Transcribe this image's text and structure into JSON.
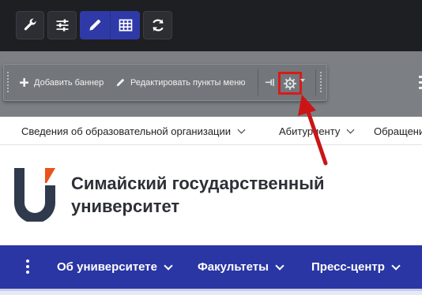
{
  "admin_toolbar": {
    "buttons": [
      {
        "icon": "wrench-icon"
      },
      {
        "icon": "sliders-icon"
      },
      {
        "icon": "pencil-icon",
        "active": true
      },
      {
        "icon": "table-grid-icon",
        "active": true
      },
      {
        "icon": "refresh-icon"
      }
    ],
    "active_color": "#2f3aa8"
  },
  "edit_toolbar": {
    "add_banner_label": "Добавить баннер",
    "edit_menu_label": "Редактировать пункты меню",
    "highlight_color": "#d91a1a"
  },
  "sub_nav": {
    "items": [
      {
        "label": "Сведения об образовательной организации"
      },
      {
        "label": "Абитуриенту"
      },
      {
        "label": "Обращени"
      }
    ]
  },
  "header": {
    "title_line1": "Симайский государственный",
    "title_line2": "университет",
    "logo_colors": {
      "primary": "#2f3b4c",
      "accent": "#e8541c"
    }
  },
  "main_nav": {
    "items": [
      {
        "label": "Об университете"
      },
      {
        "label": "Факультеты"
      },
      {
        "label": "Пресс-центр"
      }
    ],
    "background": "#2a36a3"
  }
}
